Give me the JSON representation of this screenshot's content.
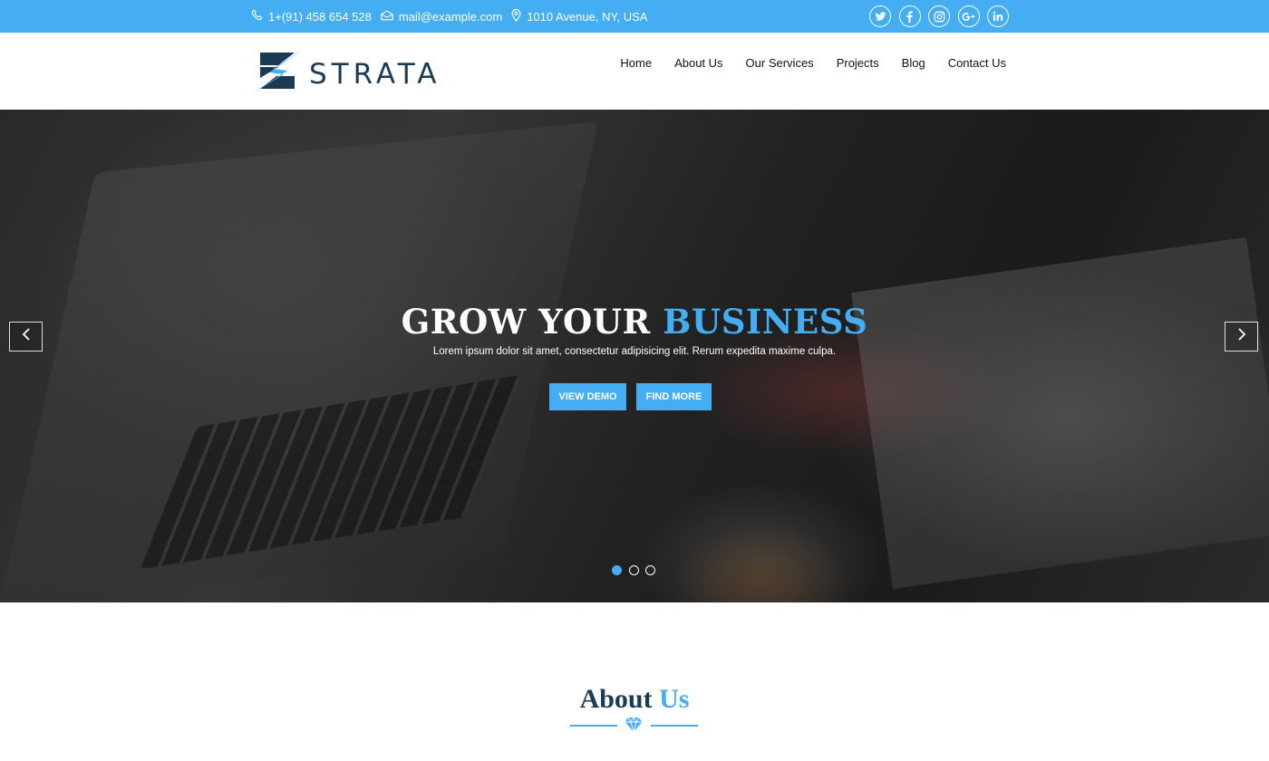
{
  "topbar": {
    "phone": "1+(91) 458 654 528",
    "email": "mail@example.com",
    "address": "1010 Avenue, NY, USA",
    "social": [
      "twitter-icon",
      "facebook-icon",
      "instagram-icon",
      "google-plus-icon",
      "linkedin-icon"
    ]
  },
  "header": {
    "logo_text": "STRATA",
    "nav": [
      "Home",
      "About Us",
      "Our Services",
      "Projects",
      "Blog",
      "Contact Us"
    ]
  },
  "hero": {
    "title_part1": "GROW YOUR ",
    "title_part2": "BUSINESS",
    "subtitle": "Lorem ipsum dolor sit amet, consectetur adipisicing elit. Rerum expedita maxime culpa.",
    "btn_demo": "VIEW DEMO",
    "btn_more": "FIND MORE",
    "slides": 3,
    "active_slide": 1
  },
  "about": {
    "title_part1": "About ",
    "title_part2": "Us"
  },
  "colors": {
    "accent": "#45aef2",
    "navy": "#1b3b55"
  }
}
